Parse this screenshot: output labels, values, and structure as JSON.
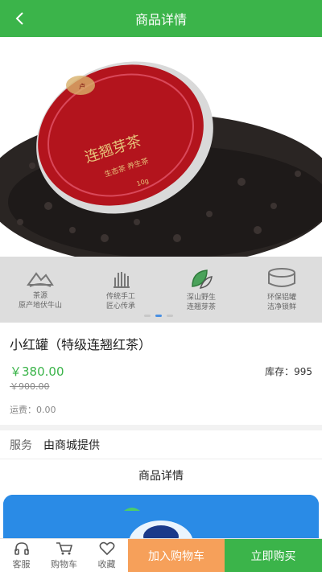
{
  "header": {
    "title": "商品详情"
  },
  "hero": {
    "lid_brand": "连翘芽茶",
    "lid_sub": "生态茶 养生茶",
    "lid_weight": "10g"
  },
  "features": [
    {
      "line1": "茶源",
      "line2": "原产地伏牛山"
    },
    {
      "line1": "传统手工",
      "line2": "匠心传承"
    },
    {
      "line1": "深山野生",
      "line2": "连翘芽茶"
    },
    {
      "line1": "环保铝罐",
      "line2": "洁净锁鲜"
    }
  ],
  "product": {
    "name": "小红罐（特级连翘红茶）",
    "price": "￥380.00",
    "old_price": "￥900.00",
    "stock": "库存：995",
    "shipping": "运费：0.00"
  },
  "service": {
    "label": "服务",
    "value": "由商城提供"
  },
  "details": {
    "title": "商品详情"
  },
  "tabbar": {
    "service": "客服",
    "cart": "购物车",
    "favorite": "收藏",
    "add_to_cart": "加入购物车",
    "buy_now": "立即购买"
  },
  "colors": {
    "brand_green": "#3bb44a",
    "price_green": "#3bb44a",
    "add_cart_orange": "#f6a05a",
    "tea_lid_red": "#b3141d"
  }
}
